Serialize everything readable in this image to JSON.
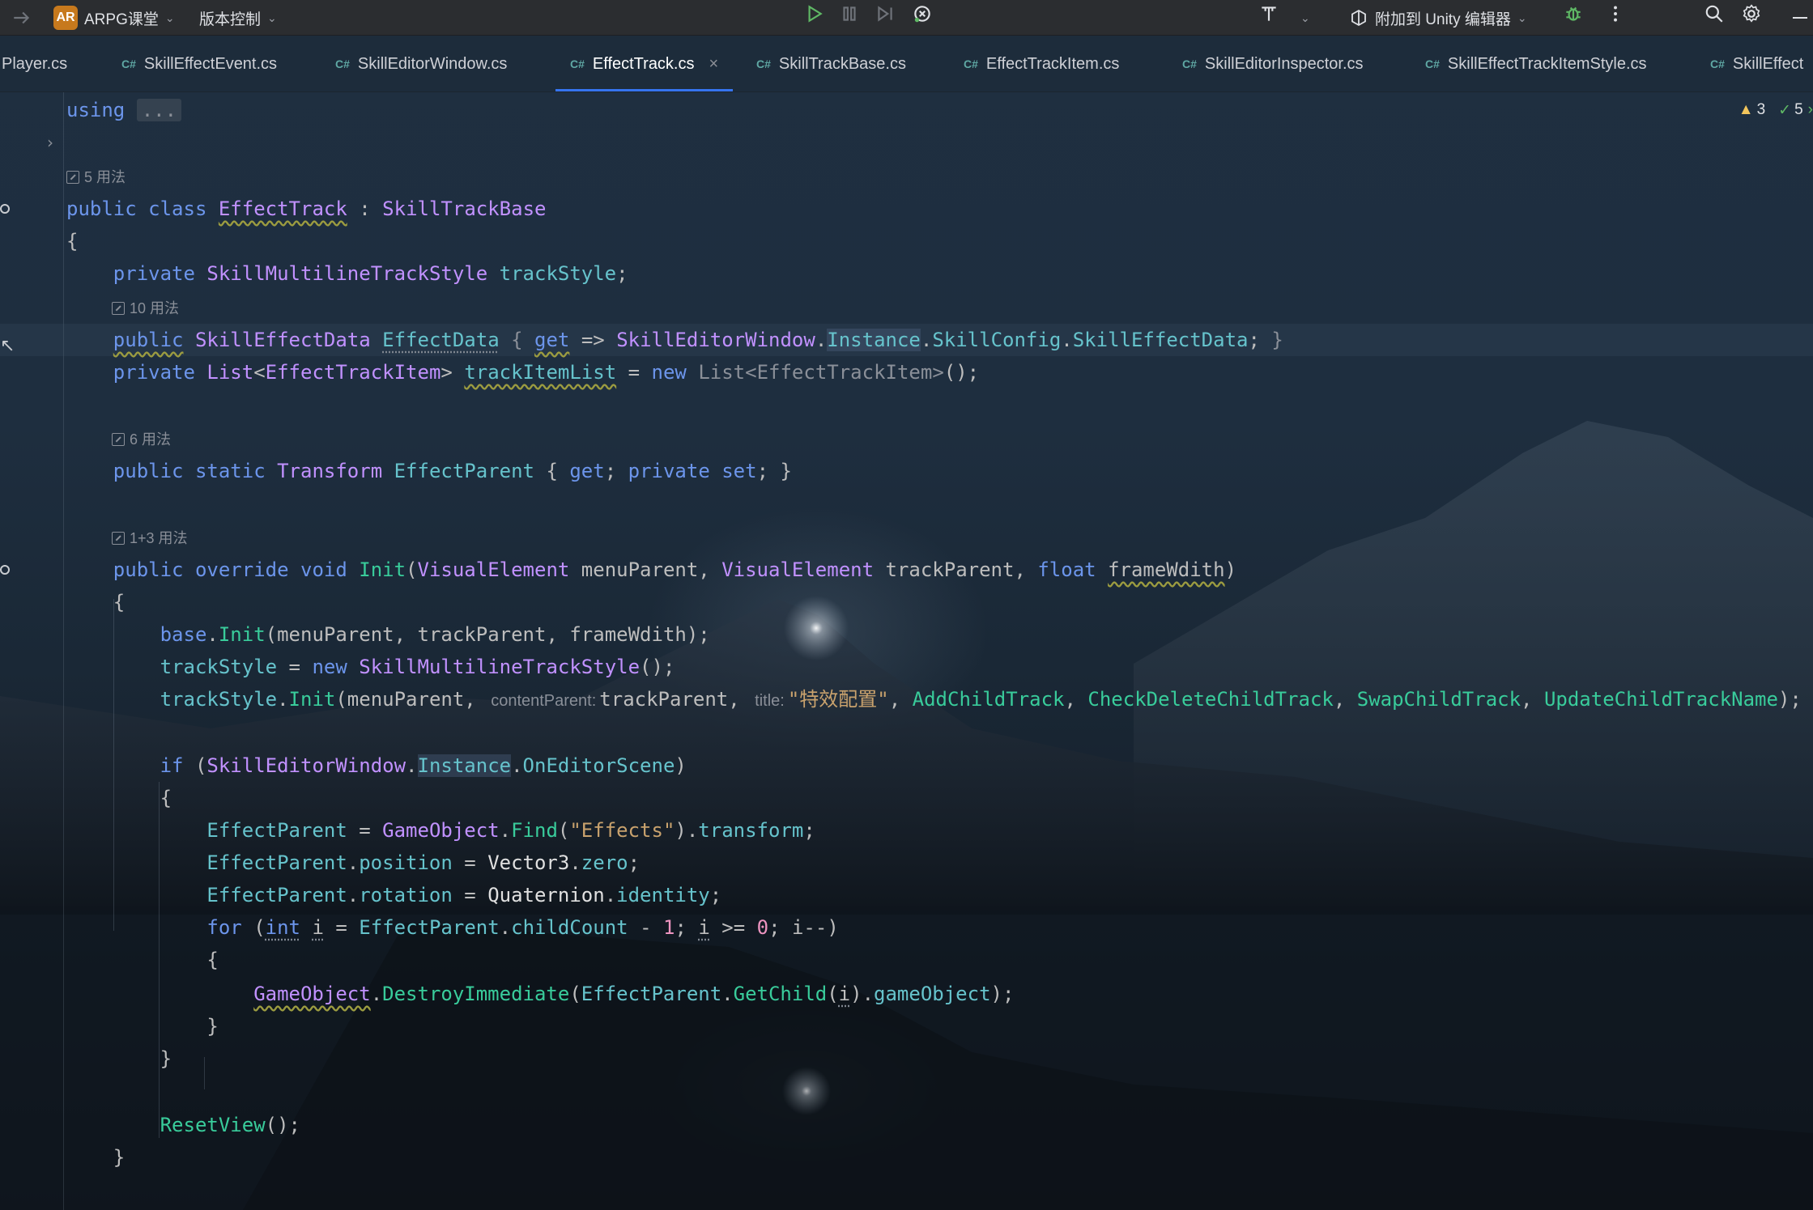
{
  "titlebar": {
    "project_badge": "AR",
    "project_name": "ARPG课堂",
    "vcs_label": "版本控制",
    "attach_label": "附加到 Unity 编辑器",
    "icons": [
      "back-arrow-icon",
      "run-icon",
      "pause-icon",
      "step-icon",
      "debug-attach-icon",
      "build-icon",
      "attach-icon",
      "bug-icon",
      "more-icon",
      "search-icon",
      "settings-icon",
      "minimize-icon"
    ]
  },
  "tabs": [
    {
      "lang": "",
      "label": "Player.cs"
    },
    {
      "lang": "C#",
      "label": "SkillEffectEvent.cs"
    },
    {
      "lang": "C#",
      "label": "SkillEditorWindow.cs"
    },
    {
      "lang": "C#",
      "label": "EffectTrack.cs",
      "active": true,
      "close": "×"
    },
    {
      "lang": "C#",
      "label": "SkillTrackBase.cs"
    },
    {
      "lang": "C#",
      "label": "EffectTrackItem.cs"
    },
    {
      "lang": "C#",
      "label": "SkillEditorInspector.cs"
    },
    {
      "lang": "C#",
      "label": "SkillEffectTrackItemStyle.cs"
    },
    {
      "lang": "C#",
      "label": "SkillEffect"
    }
  ],
  "inspections": {
    "warnings": "3",
    "ok": "5"
  },
  "hints": {
    "h1": "5 用法",
    "h2": "10 用法",
    "h3": "6 用法",
    "h4": "1+3 用法"
  },
  "code": {
    "using": "using",
    "using_fold": "...",
    "inlay_content_parent": "contentParent:",
    "inlay_title": "title:",
    "title_string": "\"特效配置\"",
    "effects_string": "\"Effects\""
  }
}
